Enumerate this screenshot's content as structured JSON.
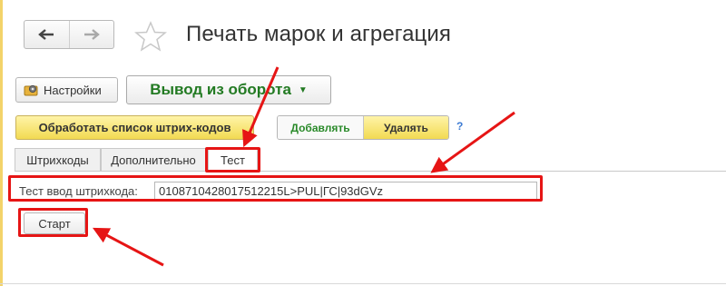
{
  "window": {
    "title": "Печать марок и агрегация"
  },
  "nav": {
    "back_icon": "arrow-left-icon",
    "forward_icon": "arrow-right-icon",
    "favorite_icon": "star-icon"
  },
  "toolbar": {
    "settings_label": "Настройки",
    "settings_icon": "gear-icon",
    "mode_value": "Вывод из оборота",
    "process_label": "Обработать список штрих-кодов",
    "add_label": "Добавлять",
    "delete_label": "Удалять",
    "help_label": "?"
  },
  "tabs": [
    {
      "label": "Штрихкоды"
    },
    {
      "label": "Дополнительно"
    },
    {
      "label": "Тест"
    }
  ],
  "test": {
    "field_label": "Тест ввод штрихкода:",
    "field_value": "0108710428017512215L>PUL|ГС|93dGVz",
    "start_label": "Старт"
  },
  "colors": {
    "accent_yellow": "#f2da52",
    "mode_green": "#227a22",
    "highlight_red": "#e61515"
  }
}
